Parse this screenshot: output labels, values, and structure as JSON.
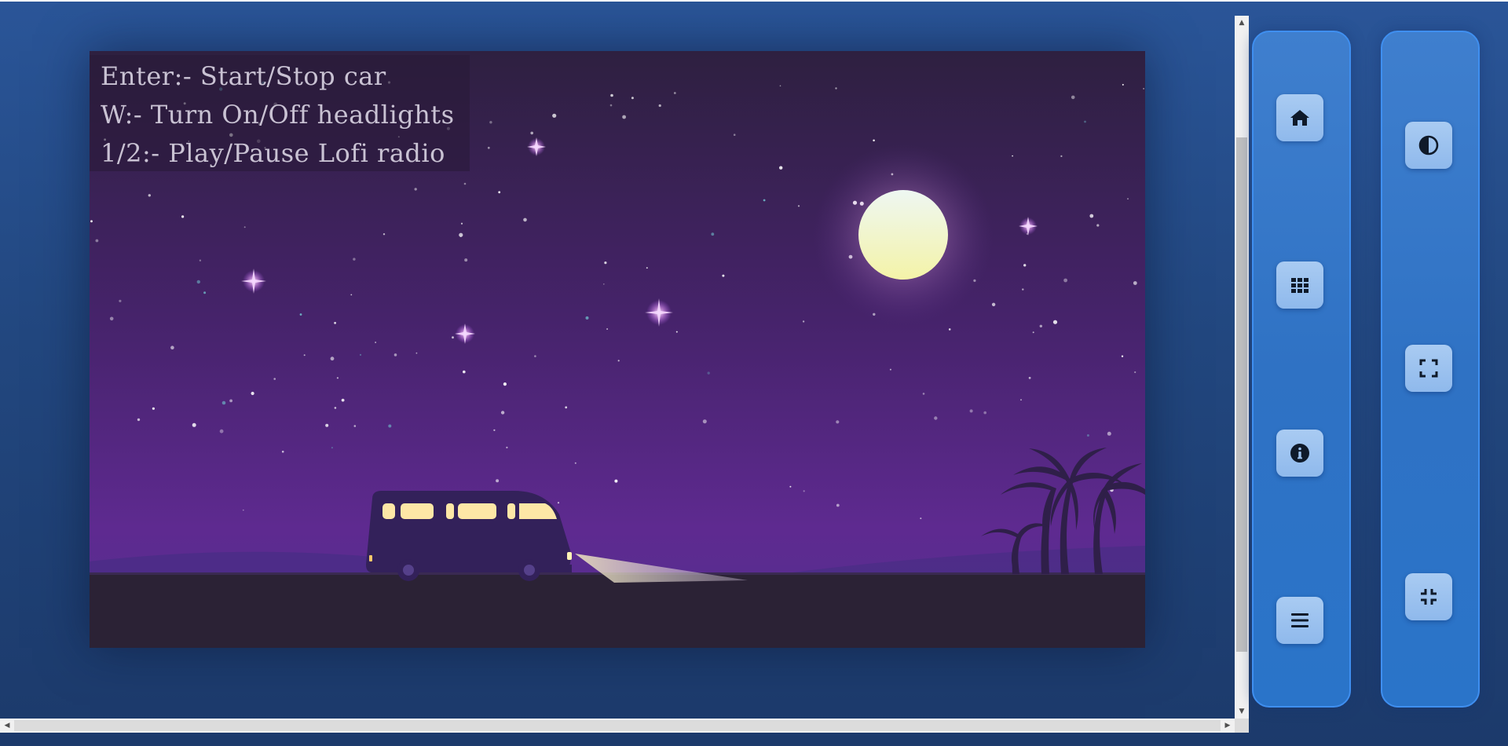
{
  "scene": {
    "help_lines": [
      "Enter:- Start/Stop car",
      "W:- Turn On/Off headlights",
      "1/2:- Play/Pause Lofi radio"
    ]
  },
  "colors": {
    "page_background": "#22477f",
    "panel": "#2f72c4",
    "panel_border": "#3f8ff0",
    "button": "#9cc2ef",
    "sky_top": "#2e2040",
    "sky_bottom": "#5b2a8c",
    "ground": "#2b2235",
    "moon": "#f3f5c8"
  },
  "left_panel": {
    "buttons": [
      {
        "name": "home",
        "icon": "home-icon"
      },
      {
        "name": "apps",
        "icon": "grid-icon"
      },
      {
        "name": "info",
        "icon": "info-icon"
      },
      {
        "name": "menu",
        "icon": "hamburger-menu-icon"
      }
    ]
  },
  "right_panel": {
    "buttons": [
      {
        "name": "contrast",
        "icon": "contrast-icon"
      },
      {
        "name": "fullscreen",
        "icon": "fullscreen-icon"
      },
      {
        "name": "exit-fullscreen",
        "icon": "exit-fullscreen-icon"
      }
    ]
  }
}
